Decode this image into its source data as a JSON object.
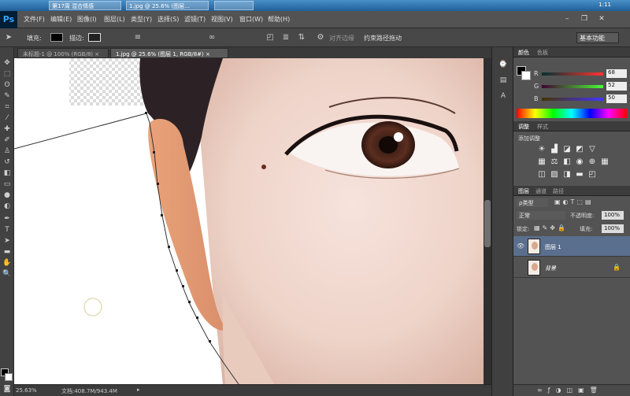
{
  "taskbar": {
    "items": [
      "第17周 混合情感",
      "1.jpg @ 25.6% (图层...",
      ""
    ],
    "clock": "1:11"
  },
  "app": {
    "icon_text": "Ps"
  },
  "menu": {
    "items": [
      "文件(F)",
      "编辑(E)",
      "图像(I)",
      "图层(L)",
      "类型(Y)",
      "选择(S)",
      "滤镜(T)",
      "视图(V)",
      "窗口(W)",
      "帮助(H)"
    ]
  },
  "options": {
    "fill_label": "填充:",
    "stroke_label": "描边:",
    "align_edges": "对齐边缘",
    "rubber_band": "约束路径拖动",
    "workspace": "基本功能"
  },
  "doc_tabs": [
    {
      "label": "未标题-1 @ 100% (RGB/8) ×",
      "active": false
    },
    {
      "label": "1.jpg @ 25.6% (图层 1, RGB/8#) ×",
      "active": true
    }
  ],
  "status": {
    "zoom": "25.63%",
    "doc_info": "文档:408.7M/943.4M"
  },
  "color_panel": {
    "tabs": [
      "颜色",
      "色板"
    ],
    "r_label": "R",
    "r_value": "68",
    "g_label": "G",
    "g_value": "52",
    "b_label": "B",
    "b_value": "50"
  },
  "adjust_panel": {
    "tabs": [
      "调整",
      "样式"
    ],
    "title": "添加调整"
  },
  "layers_panel": {
    "tabs": [
      "图层",
      "通道",
      "路径"
    ],
    "filter_label": "ρ类型",
    "blend_mode": "正常",
    "opacity_label": "不透明度:",
    "opacity_value": "100%",
    "lock_label": "锁定:",
    "fill_label": "填充:",
    "fill_value": "100%",
    "layers": [
      {
        "name": "图层 1",
        "selected": true
      },
      {
        "name": "背景",
        "selected": false
      }
    ]
  }
}
